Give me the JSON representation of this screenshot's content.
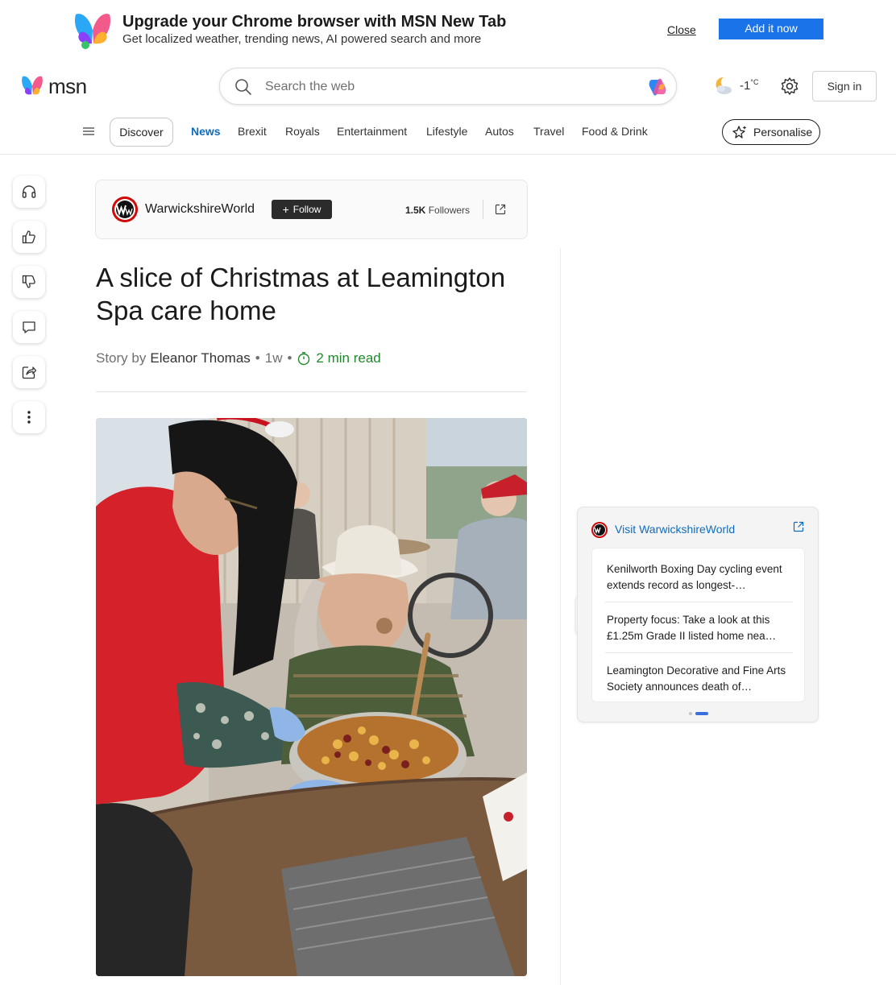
{
  "promo": {
    "title": "Upgrade your Chrome browser with MSN New Tab",
    "subtitle": "Get localized weather, trending news, AI powered search and more",
    "close_label": "Close",
    "add_label": "Add it now"
  },
  "header": {
    "logo_text": "msn",
    "search_placeholder": "Search the web",
    "weather_temp": "-1",
    "weather_unit": "°C",
    "signin_label": "Sign in"
  },
  "nav": {
    "discover_label": "Discover",
    "items": [
      "News",
      "Brexit",
      "Royals",
      "Entertainment",
      "Lifestyle",
      "Autos",
      "Travel",
      "Food & Drink"
    ],
    "active_item": "News",
    "personalise_label": "Personalise"
  },
  "publisher": {
    "name": "WarwickshireWorld",
    "follow_label": "Follow",
    "followers_count": "1.5K",
    "followers_label": "Followers"
  },
  "article": {
    "title": "A slice of Christmas at Leamington Spa care home",
    "byline_prefix": "Story by",
    "author": "Eleanor Thomas",
    "age": "1w",
    "read_time": "2 min read"
  },
  "widget": {
    "visit_label": "Visit WarwickshireWorld",
    "items": [
      "Kenilworth Boxing Day cycling event extends record as longest-…",
      "Property focus: Take a look at this £1.25m Grade II listed home nea…",
      "Leamington Decorative and Fine Arts Society announces death of…"
    ],
    "page_count": 2,
    "active_page": 2
  },
  "colors": {
    "accent_blue": "#0f6cbd",
    "promo_button": "#1a73e8",
    "read_time_green": "#1f8a2c",
    "publisher_red": "#d10a0a"
  },
  "icons": [
    "listen-icon",
    "like-icon",
    "dislike-icon",
    "comment-icon",
    "share-icon",
    "more-icon"
  ]
}
